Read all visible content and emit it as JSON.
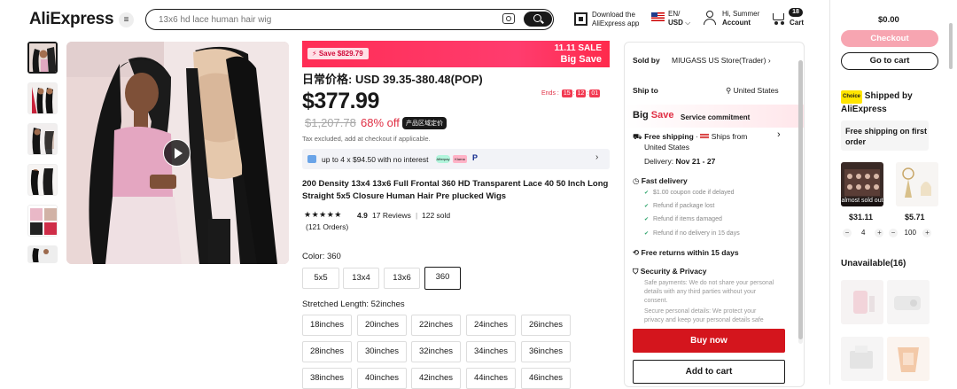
{
  "header": {
    "logo": "AliExpress",
    "search_placeholder": "13x6 hd lace human hair wig",
    "download_line1": "Download the",
    "download_line2": "AliExpress app",
    "lang_line1": "EN/",
    "lang_line2": "USD",
    "user_line1": "Hi, Summer",
    "user_line2": "Account",
    "cart_count": "18",
    "cart_label": "Cart"
  },
  "product": {
    "banner_save": "Save $829.79",
    "banner_sale_line1": "11.11 SALE",
    "banner_sale_line2": "Big Save",
    "price_range": "日常价格: USD 39.35-380.48(POP)",
    "ends_label": "Ends :",
    "timer": [
      "15",
      "12",
      "01"
    ],
    "price": "$377.99",
    "old_price": "$1,207.78",
    "discount": "68% off",
    "chip": "产品区域定价",
    "tax_note": "Tax excluded, add at checkout if applicable.",
    "installment": "up to 4 x $94.50 with no interest",
    "pay_logos": [
      "Afterpay",
      "Klarna",
      "P"
    ],
    "title": "200 Density 13x4 13x6 Full Frontal 360 HD Transparent Lace 40 50 Inch Long Straight 5x5 Closure Human Hair Pre plucked Wigs",
    "stars": "★★★★★",
    "rating": "4.9",
    "reviews": "17 Reviews",
    "sold": "122 sold",
    "orders": "(121 Orders)",
    "color_label": "Color: 360",
    "colors": [
      "5x5",
      "13x4",
      "13x6",
      "360"
    ],
    "selected_color": "360",
    "length_label": "Stretched Length: 52inches",
    "lengths": [
      "18inches",
      "20inches",
      "22inches",
      "24inches",
      "26inches",
      "28inches",
      "30inches",
      "32inches",
      "34inches",
      "36inches",
      "38inches",
      "40inches",
      "42inches",
      "44inches",
      "46inches"
    ]
  },
  "panel": {
    "sold_by_label": "Sold by",
    "store": "MIUGASS US Store(Trader)",
    "ship_to_label": "Ship to",
    "ship_to": "United States",
    "bigsave_big": "Big",
    "bigsave_save": "Save",
    "commitment": "Service commitment",
    "free_shipping": "Free shipping",
    "ships_from": "Ships from",
    "ships_from_2": "United States",
    "delivery": "Delivery:",
    "delivery_dates": "Nov 21 - 27",
    "fast_delivery": "Fast delivery",
    "fast_items": [
      "$1.00 coupon code if delayed",
      "Refund if package lost",
      "Refund if items damaged",
      "Refund if no delivery in 15 days"
    ],
    "free_returns": "Free returns within 15 days",
    "security": "Security & Privacy",
    "security_text1": "Safe payments: We do not share your personal details with any third parties without your consent.",
    "security_text2": "Secure personal details: We protect your privacy and keep your personal details safe",
    "buy_now": "Buy now",
    "add_to_cart": "Add to cart"
  },
  "side": {
    "total": "$0.00",
    "checkout": "Checkout",
    "go_to_cart": "Go to cart",
    "choice_badge": "Choice",
    "shipped_by": "Shipped by",
    "shipped_by_2": "AliExpress",
    "free_ship_first": "Free shipping on first order",
    "item1_price": "$31.11",
    "item1_sold_out": "almost sold out",
    "item1_qty": "4",
    "item2_price": "$5.71",
    "item2_qty": "100",
    "unavailable": "Unavailable(16)"
  }
}
